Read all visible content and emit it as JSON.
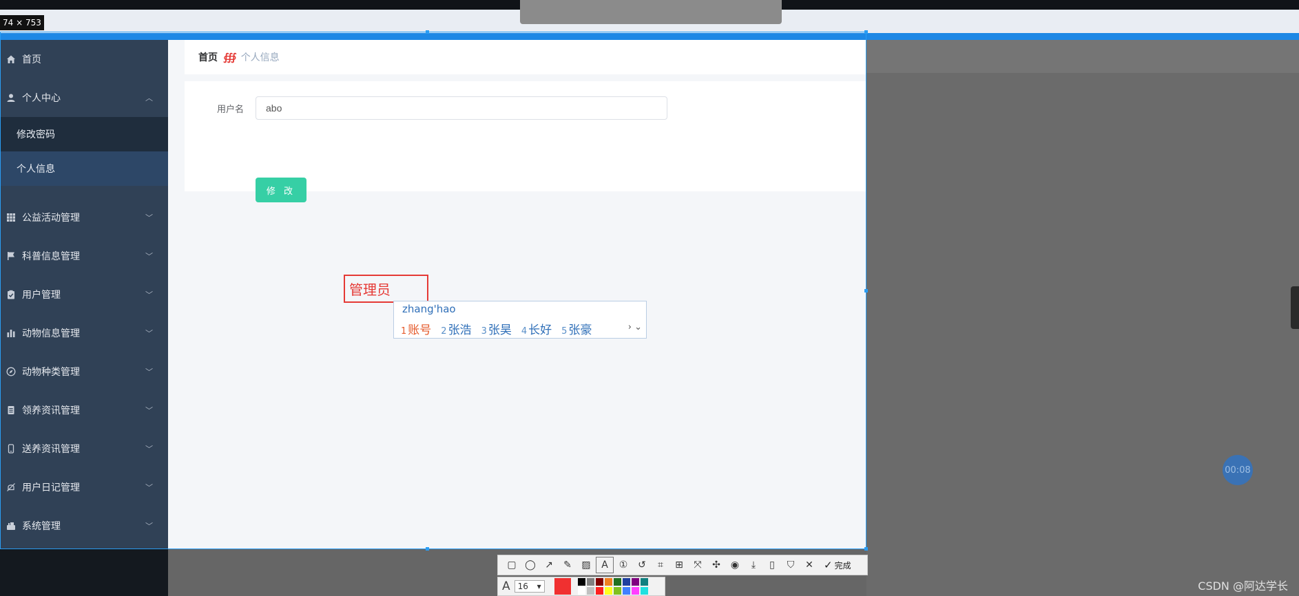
{
  "size_label": "74 × 753",
  "sidebar": {
    "items": [
      {
        "label": "首页",
        "icon": "home-icon"
      },
      {
        "label": "个人中心",
        "icon": "user-icon",
        "expanded": true,
        "children": [
          {
            "label": "修改密码"
          },
          {
            "label": "个人信息",
            "active": true
          }
        ]
      },
      {
        "label": "公益活动管理",
        "icon": "grid-icon"
      },
      {
        "label": "科普信息管理",
        "icon": "flag-icon"
      },
      {
        "label": "用户管理",
        "icon": "clipboard-check-icon"
      },
      {
        "label": "动物信息管理",
        "icon": "bar-chart-icon"
      },
      {
        "label": "动物种类管理",
        "icon": "compass-icon"
      },
      {
        "label": "领养资讯管理",
        "icon": "document-icon"
      },
      {
        "label": "送养资讯管理",
        "icon": "phone-icon"
      },
      {
        "label": "用户日记管理",
        "icon": "bell-off-icon"
      },
      {
        "label": "系统管理",
        "icon": "settings-icon"
      }
    ]
  },
  "breadcrumb": {
    "home": "首页",
    "separator": "∰",
    "current": "个人信息"
  },
  "form": {
    "username_label": "用户名",
    "username_value": "abo",
    "submit_label": "修 改"
  },
  "annotation": {
    "text": "管理员"
  },
  "ime": {
    "pinyin": "zhang'hao",
    "candidates": [
      {
        "n": "1",
        "text": "账号"
      },
      {
        "n": "2",
        "text": "张浩"
      },
      {
        "n": "3",
        "text": "张昊"
      },
      {
        "n": "4",
        "text": "长好"
      },
      {
        "n": "5",
        "text": "张豪"
      }
    ]
  },
  "timer": "00:08",
  "toolbar": {
    "done_label": "完成",
    "font_size": "16",
    "current_color": "#f03030",
    "swatches": [
      "#000000",
      "#808080",
      "#800000",
      "#f08020",
      "#207020",
      "#2040a0",
      "#800080",
      "#108080",
      "#ffffff",
      "#c0c0c0",
      "#ff2020",
      "#ffff20",
      "#80c020",
      "#4080ff",
      "#ff40ff",
      "#20e0e0"
    ]
  },
  "watermark": "CSDN @阿达学长"
}
